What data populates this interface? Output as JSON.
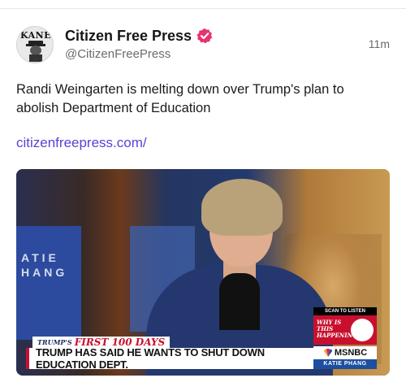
{
  "post": {
    "author": {
      "display_name": "Citizen Free Press",
      "handle": "@CitizenFreePress",
      "avatar_text": "KANE",
      "verified": true
    },
    "timestamp": "11m",
    "text": "Randi Weingarten is melting down over Trump's plan to abolish Department of Education",
    "link": "citizenfreepress.com/"
  },
  "video": {
    "wall_text": "ATIE\nHANG",
    "lower_third": {
      "kicker_small": "TRUMP'S",
      "kicker_big": "FIRST 100 DAYS",
      "headline": "TRUMP HAS SAID HE WANTS TO SHUT DOWN EDUCATION DEPT."
    },
    "bug": {
      "scan": "SCAN TO LISTEN",
      "qr_text": "WHY IS THIS HAPPENING?",
      "network": "MSNBC",
      "show": "KATIE PHANG"
    }
  },
  "colors": {
    "verified_badge": "#e8336f",
    "link": "#5b3fd6",
    "accent_red": "#c8102e"
  },
  "icons": [
    "verified-badge-icon",
    "avatar-image",
    "msnbc-peacock-icon"
  ]
}
